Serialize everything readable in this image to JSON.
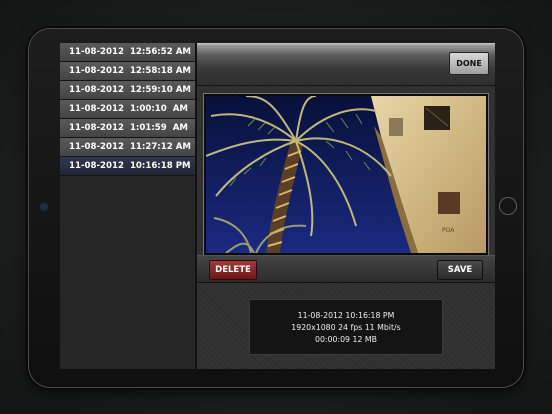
{
  "recordings": [
    {
      "label": "11-08-2012  12:56:52 AM",
      "selected": false
    },
    {
      "label": "11-08-2012  12:58:18 AM",
      "selected": false
    },
    {
      "label": "11-08-2012  12:59:10 AM",
      "selected": false
    },
    {
      "label": "11-08-2012  1:00:10  AM",
      "selected": false
    },
    {
      "label": "11-08-2012  1:01:59  AM",
      "selected": false
    },
    {
      "label": "11-08-2012  11:27:12 AM",
      "selected": false
    },
    {
      "label": "11-08-2012  10:16:18 PM",
      "selected": true
    }
  ],
  "toolbar": {
    "done_label": "DONE"
  },
  "actions": {
    "delete_label": "DELETE",
    "save_label": "SAVE"
  },
  "info": {
    "line1": "11-08-2012  10:16:18 PM",
    "line2": "1920x1080  24 fps  11 Mbit/s",
    "line3": "00:00:09  12 MB"
  },
  "photo": {
    "sign_text": "POA"
  },
  "colors": {
    "selected_row": "#2a2e42",
    "delete_button": "#8b2323",
    "sky": "#0f1a55"
  }
}
